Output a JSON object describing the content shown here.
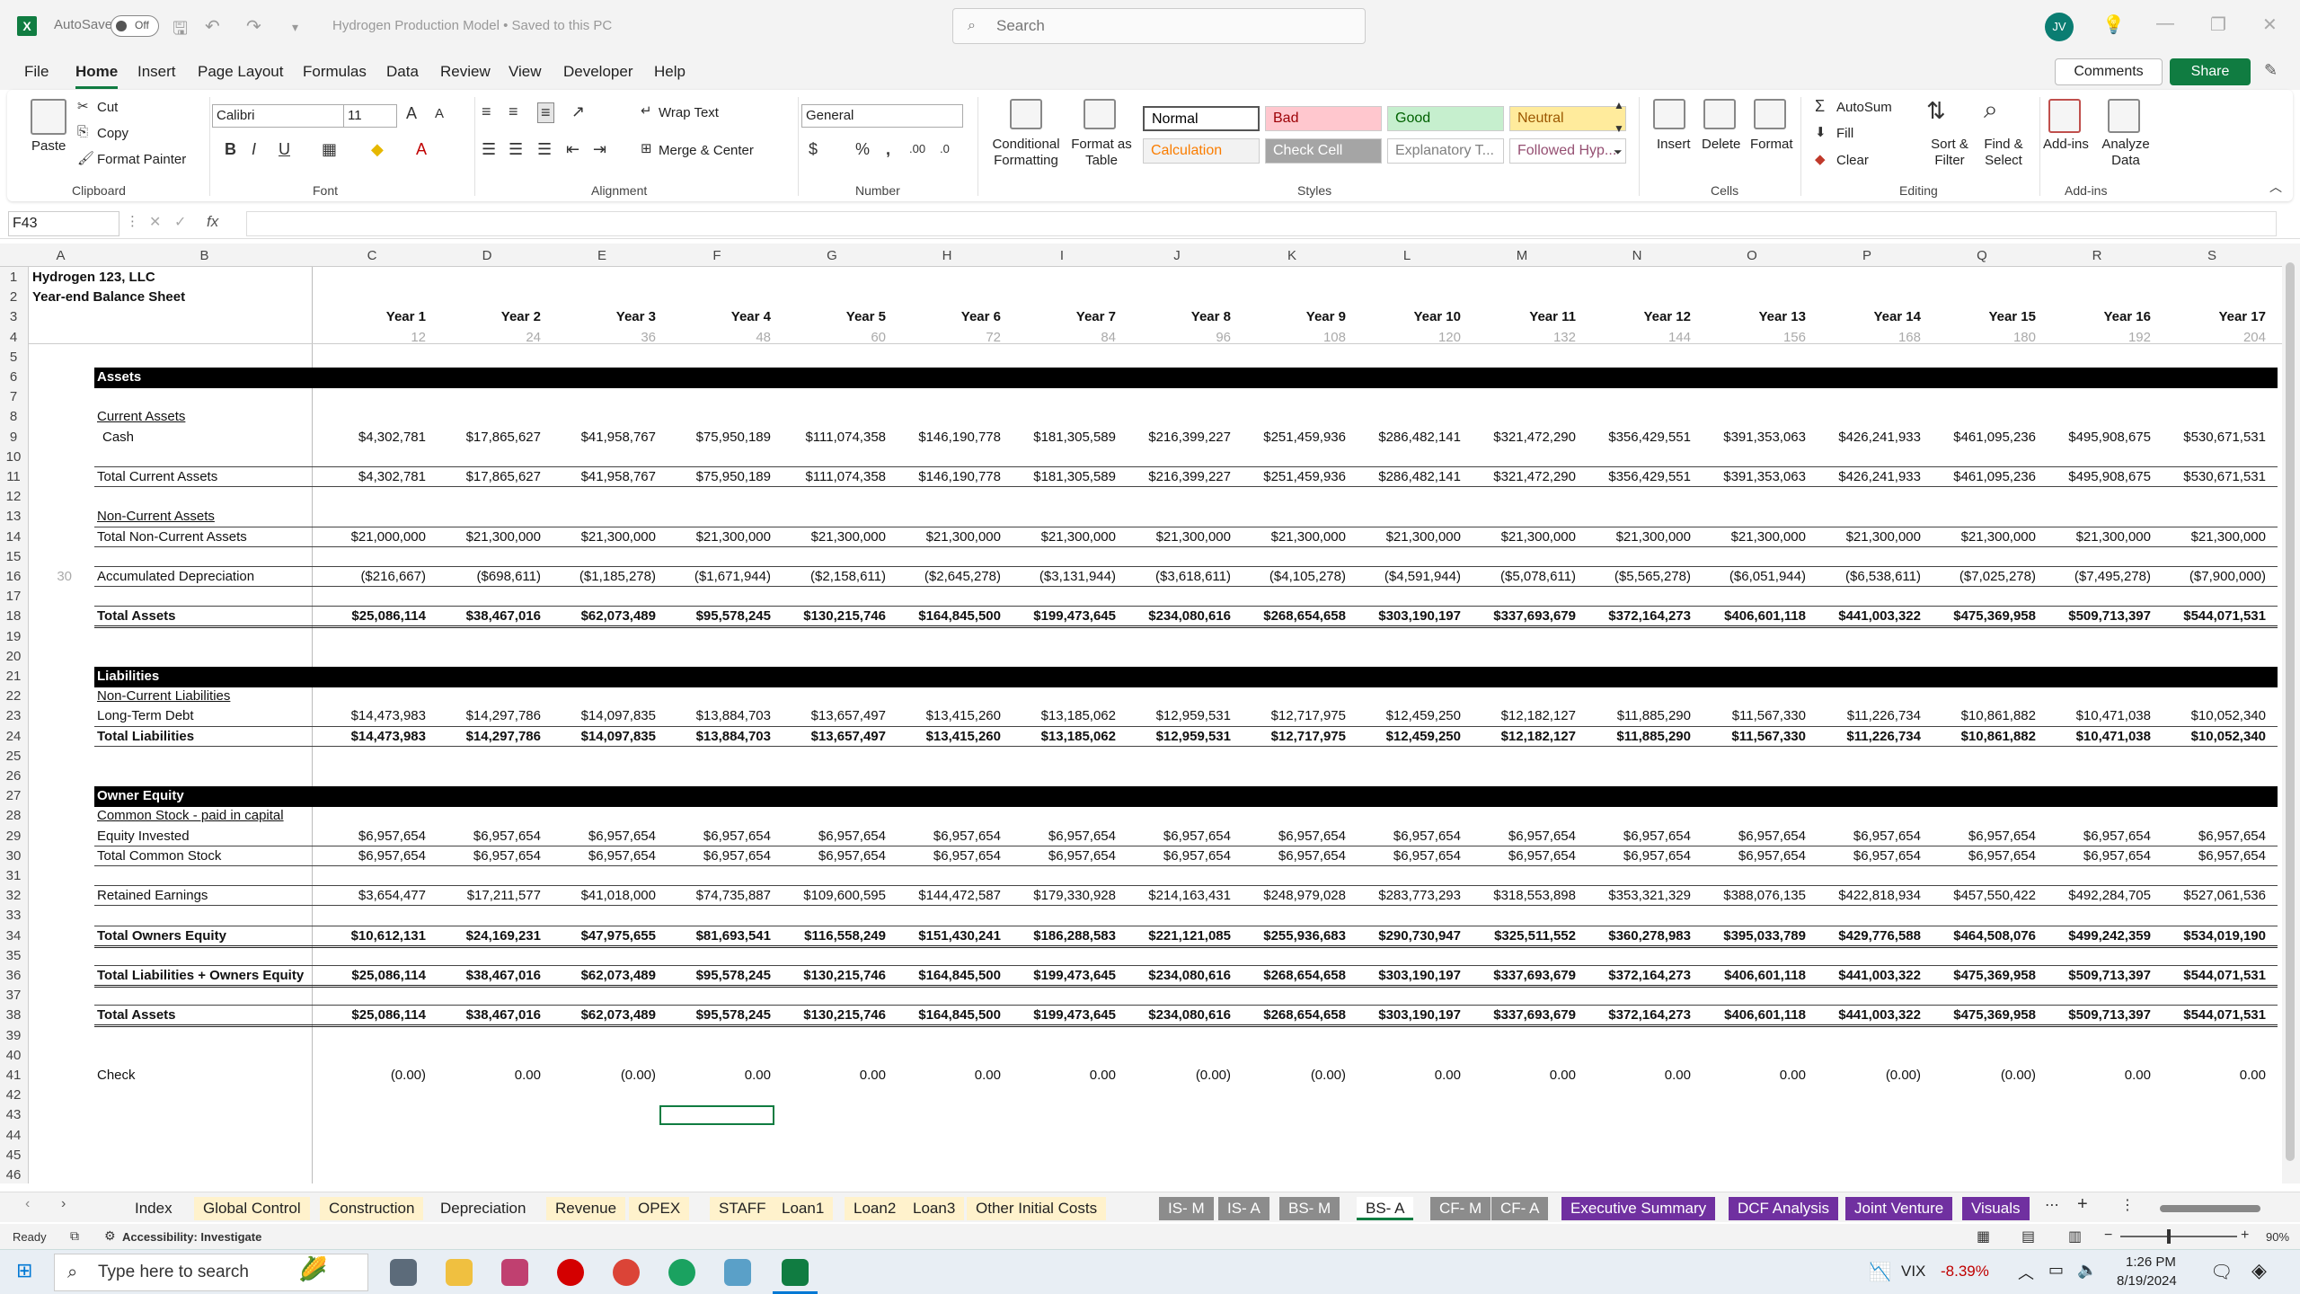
{
  "app": {
    "autosave_label": "AutoSave",
    "autosave_state": "Off",
    "document_title": "Hydrogen Production Model • Saved to this PC",
    "search_placeholder": "Search",
    "user_initials": "JV"
  },
  "menu": [
    "File",
    "Home",
    "Insert",
    "Page Layout",
    "Formulas",
    "Data",
    "Review",
    "View",
    "Developer",
    "Help"
  ],
  "active_menu": "Home",
  "comments_label": "Comments",
  "share_label": "Share",
  "ribbon": {
    "clipboard": {
      "paste": "Paste",
      "cut": "Cut",
      "copy": "Copy",
      "format_painter": "Format Painter",
      "label": "Clipboard"
    },
    "font": {
      "name": "Calibri",
      "size": "11",
      "label": "Font"
    },
    "alignment": {
      "wrap_text": "Wrap Text",
      "merge_center": "Merge & Center",
      "label": "Alignment"
    },
    "number": {
      "format": "General",
      "label": "Number"
    },
    "styles": {
      "conditional_formatting": "Conditional Formatting",
      "format_as_table": "Format as Table",
      "label": "Styles",
      "cells": [
        {
          "name": "Normal",
          "bg": "#ffffff",
          "fg": "#000000"
        },
        {
          "name": "Bad",
          "bg": "#ffc7ce",
          "fg": "#9c0006"
        },
        {
          "name": "Good",
          "bg": "#c6efce",
          "fg": "#006100"
        },
        {
          "name": "Neutral",
          "bg": "#ffeb9c",
          "fg": "#9c5700"
        },
        {
          "name": "Calculation",
          "bg": "#f2f2f2",
          "fg": "#fa7d00"
        },
        {
          "name": "Check Cell",
          "bg": "#a5a5a5",
          "fg": "#ffffff"
        },
        {
          "name": "Explanatory T...",
          "bg": "#ffffff",
          "fg": "#7f7f7f"
        },
        {
          "name": "Followed Hyp...",
          "bg": "#ffffff",
          "fg": "#954f72"
        }
      ]
    },
    "cells": {
      "insert": "Insert",
      "delete": "Delete",
      "format": "Format",
      "label": "Cells"
    },
    "editing": {
      "autosum": "AutoSum",
      "fill": "Fill",
      "clear": "Clear",
      "sort_filter": "Sort & Filter",
      "find_select": "Find & Select",
      "label": "Editing"
    },
    "addins": {
      "addins": "Add-ins",
      "analyze": "Analyze Data",
      "label": "Add-ins"
    }
  },
  "formula_bar": {
    "name_box": "F43",
    "fx": "fx",
    "content": ""
  },
  "columns": [
    "A",
    "B",
    "C",
    "D",
    "E",
    "F",
    "G",
    "H",
    "I",
    "J",
    "K",
    "L",
    "M",
    "N",
    "O",
    "P",
    "Q",
    "R",
    "S"
  ],
  "sheet": {
    "company": "Hydrogen 123, LLC",
    "title": "Year-end Balance Sheet",
    "years": [
      "Year 1",
      "Year 2",
      "Year 3",
      "Year 4",
      "Year 5",
      "Year 6",
      "Year 7",
      "Year 8",
      "Year 9",
      "Year 10",
      "Year 11",
      "Year 12",
      "Year 13",
      "Year 14",
      "Year 15",
      "Year 16",
      "Year 17"
    ],
    "months": [
      "12",
      "24",
      "36",
      "48",
      "60",
      "72",
      "84",
      "96",
      "108",
      "120",
      "132",
      "144",
      "156",
      "168",
      "180",
      "192",
      "204"
    ],
    "a16": "30",
    "rows": [
      {
        "row": 9,
        "label": "Cash",
        "indent": true,
        "bold": false,
        "values": [
          "$4,302,781",
          "$17,865,627",
          "$41,958,767",
          "$75,950,189",
          "$111,074,358",
          "$146,190,778",
          "$181,305,589",
          "$216,399,227",
          "$251,459,936",
          "$286,482,141",
          "$321,472,290",
          "$356,429,551",
          "$391,353,063",
          "$426,241,933",
          "$461,095,236",
          "$495,908,675",
          "$530,671,531"
        ]
      },
      {
        "row": 11,
        "label": "Total Current Assets",
        "bold": false,
        "values": [
          "$4,302,781",
          "$17,865,627",
          "$41,958,767",
          "$75,950,189",
          "$111,074,358",
          "$146,190,778",
          "$181,305,589",
          "$216,399,227",
          "$251,459,936",
          "$286,482,141",
          "$321,472,290",
          "$356,429,551",
          "$391,353,063",
          "$426,241,933",
          "$461,095,236",
          "$495,908,675",
          "$530,671,531"
        ]
      },
      {
        "row": 14,
        "label": "Total Non-Current Assets",
        "bold": false,
        "values": [
          "$21,000,000",
          "$21,300,000",
          "$21,300,000",
          "$21,300,000",
          "$21,300,000",
          "$21,300,000",
          "$21,300,000",
          "$21,300,000",
          "$21,300,000",
          "$21,300,000",
          "$21,300,000",
          "$21,300,000",
          "$21,300,000",
          "$21,300,000",
          "$21,300,000",
          "$21,300,000",
          "$21,300,000"
        ]
      },
      {
        "row": 16,
        "label": "Accumulated Depreciation",
        "bold": false,
        "values": [
          "($216,667)",
          "($698,611)",
          "($1,185,278)",
          "($1,671,944)",
          "($2,158,611)",
          "($2,645,278)",
          "($3,131,944)",
          "($3,618,611)",
          "($4,105,278)",
          "($4,591,944)",
          "($5,078,611)",
          "($5,565,278)",
          "($6,051,944)",
          "($6,538,611)",
          "($7,025,278)",
          "($7,495,278)",
          "($7,900,000)"
        ]
      },
      {
        "row": 18,
        "label": "Total Assets",
        "bold": true,
        "values": [
          "$25,086,114",
          "$38,467,016",
          "$62,073,489",
          "$95,578,245",
          "$130,215,746",
          "$164,845,500",
          "$199,473,645",
          "$234,080,616",
          "$268,654,658",
          "$303,190,197",
          "$337,693,679",
          "$372,164,273",
          "$406,601,118",
          "$441,003,322",
          "$475,369,958",
          "$509,713,397",
          "$544,071,531"
        ]
      },
      {
        "row": 23,
        "label": "Long-Term Debt",
        "bold": false,
        "values": [
          "$14,473,983",
          "$14,297,786",
          "$14,097,835",
          "$13,884,703",
          "$13,657,497",
          "$13,415,260",
          "$13,185,062",
          "$12,959,531",
          "$12,717,975",
          "$12,459,250",
          "$12,182,127",
          "$11,885,290",
          "$11,567,330",
          "$11,226,734",
          "$10,861,882",
          "$10,471,038",
          "$10,052,340"
        ]
      },
      {
        "row": 24,
        "label": "Total Liabilities",
        "bold": true,
        "values": [
          "$14,473,983",
          "$14,297,786",
          "$14,097,835",
          "$13,884,703",
          "$13,657,497",
          "$13,415,260",
          "$13,185,062",
          "$12,959,531",
          "$12,717,975",
          "$12,459,250",
          "$12,182,127",
          "$11,885,290",
          "$11,567,330",
          "$11,226,734",
          "$10,861,882",
          "$10,471,038",
          "$10,052,340"
        ]
      },
      {
        "row": 29,
        "label": "Equity Invested",
        "bold": false,
        "values": [
          "$6,957,654",
          "$6,957,654",
          "$6,957,654",
          "$6,957,654",
          "$6,957,654",
          "$6,957,654",
          "$6,957,654",
          "$6,957,654",
          "$6,957,654",
          "$6,957,654",
          "$6,957,654",
          "$6,957,654",
          "$6,957,654",
          "$6,957,654",
          "$6,957,654",
          "$6,957,654",
          "$6,957,654"
        ]
      },
      {
        "row": 30,
        "label": "Total Common Stock",
        "bold": false,
        "values": [
          "$6,957,654",
          "$6,957,654",
          "$6,957,654",
          "$6,957,654",
          "$6,957,654",
          "$6,957,654",
          "$6,957,654",
          "$6,957,654",
          "$6,957,654",
          "$6,957,654",
          "$6,957,654",
          "$6,957,654",
          "$6,957,654",
          "$6,957,654",
          "$6,957,654",
          "$6,957,654",
          "$6,957,654"
        ]
      },
      {
        "row": 32,
        "label": "Retained Earnings",
        "bold": false,
        "values": [
          "$3,654,477",
          "$17,211,577",
          "$41,018,000",
          "$74,735,887",
          "$109,600,595",
          "$144,472,587",
          "$179,330,928",
          "$214,163,431",
          "$248,979,028",
          "$283,773,293",
          "$318,553,898",
          "$353,321,329",
          "$388,076,135",
          "$422,818,934",
          "$457,550,422",
          "$492,284,705",
          "$527,061,536"
        ]
      },
      {
        "row": 34,
        "label": "Total Owners Equity",
        "bold": true,
        "values": [
          "$10,612,131",
          "$24,169,231",
          "$47,975,655",
          "$81,693,541",
          "$116,558,249",
          "$151,430,241",
          "$186,288,583",
          "$221,121,085",
          "$255,936,683",
          "$290,730,947",
          "$325,511,552",
          "$360,278,983",
          "$395,033,789",
          "$429,776,588",
          "$464,508,076",
          "$499,242,359",
          "$534,019,190"
        ]
      },
      {
        "row": 36,
        "label": "Total Liabilities + Owners Equity",
        "bold": true,
        "values": [
          "$25,086,114",
          "$38,467,016",
          "$62,073,489",
          "$95,578,245",
          "$130,215,746",
          "$164,845,500",
          "$199,473,645",
          "$234,080,616",
          "$268,654,658",
          "$303,190,197",
          "$337,693,679",
          "$372,164,273",
          "$406,601,118",
          "$441,003,322",
          "$475,369,958",
          "$509,713,397",
          "$544,071,531"
        ]
      },
      {
        "row": 38,
        "label": "Total Assets",
        "bold": true,
        "values": [
          "$25,086,114",
          "$38,467,016",
          "$62,073,489",
          "$95,578,245",
          "$130,215,746",
          "$164,845,500",
          "$199,473,645",
          "$234,080,616",
          "$268,654,658",
          "$303,190,197",
          "$337,693,679",
          "$372,164,273",
          "$406,601,118",
          "$441,003,322",
          "$475,369,958",
          "$509,713,397",
          "$544,071,531"
        ]
      },
      {
        "row": 41,
        "label": "Check",
        "bold": false,
        "values": [
          "(0.00)",
          "0.00",
          "(0.00)",
          "0.00",
          "0.00",
          "0.00",
          "0.00",
          "(0.00)",
          "(0.00)",
          "0.00",
          "0.00",
          "0.00",
          "0.00",
          "(0.00)",
          "(0.00)",
          "0.00",
          "0.00"
        ]
      }
    ],
    "subheads": [
      {
        "row": 8,
        "label": "Current Assets"
      },
      {
        "row": 13,
        "label": "Non-Current Assets"
      },
      {
        "row": 22,
        "label": "Non-Current Liabilities"
      },
      {
        "row": 28,
        "label": "Common Stock - paid in capital"
      }
    ],
    "bands": [
      {
        "row": 6,
        "label": "Assets"
      },
      {
        "row": 21,
        "label": "Liabilities"
      },
      {
        "row": 27,
        "label": "Owner Equity"
      }
    ]
  },
  "tabs": [
    {
      "name": "Index",
      "bg": "#f3f3f3",
      "fg": "#222"
    },
    {
      "name": "Global Control",
      "bg": "#fff2cc",
      "fg": "#222"
    },
    {
      "name": "Construction",
      "bg": "#fff2cc",
      "fg": "#222"
    },
    {
      "name": "Depreciation",
      "bg": "#f3f3f3",
      "fg": "#222"
    },
    {
      "name": "Revenue",
      "bg": "#fff2cc",
      "fg": "#222"
    },
    {
      "name": "OPEX",
      "bg": "#fff2cc",
      "fg": "#222"
    },
    {
      "name": "STAFF",
      "bg": "#fff2cc",
      "fg": "#222"
    },
    {
      "name": "Loan1",
      "bg": "#fff2cc",
      "fg": "#222"
    },
    {
      "name": "Loan2",
      "bg": "#fff2cc",
      "fg": "#222"
    },
    {
      "name": "Loan3",
      "bg": "#fff2cc",
      "fg": "#222"
    },
    {
      "name": "Other Initial Costs",
      "bg": "#fff2cc",
      "fg": "#222"
    },
    {
      "name": "IS- M",
      "bg": "#8c8c8c",
      "fg": "#fff"
    },
    {
      "name": "IS- A",
      "bg": "#8c8c8c",
      "fg": "#fff"
    },
    {
      "name": "BS- M",
      "bg": "#8c8c8c",
      "fg": "#fff"
    },
    {
      "name": "BS- A",
      "bg": "#ffffff",
      "fg": "#222",
      "active": true
    },
    {
      "name": "CF- M",
      "bg": "#8c8c8c",
      "fg": "#fff"
    },
    {
      "name": "CF- A",
      "bg": "#8c8c8c",
      "fg": "#fff"
    },
    {
      "name": "Executive Summary",
      "bg": "#7030a0",
      "fg": "#fff"
    },
    {
      "name": "DCF Analysis",
      "bg": "#7030a0",
      "fg": "#fff"
    },
    {
      "name": "Joint Venture",
      "bg": "#7030a0",
      "fg": "#fff"
    },
    {
      "name": "Visuals",
      "bg": "#7030a0",
      "fg": "#fff"
    }
  ],
  "status": {
    "ready": "Ready",
    "accessibility": "Accessibility: Investigate",
    "zoom": "90%"
  },
  "taskbar": {
    "search_placeholder": "Type here to search",
    "vix_label": "VIX",
    "vix_change": "-8.39%",
    "time": "1:26 PM",
    "date": "8/19/2024"
  }
}
